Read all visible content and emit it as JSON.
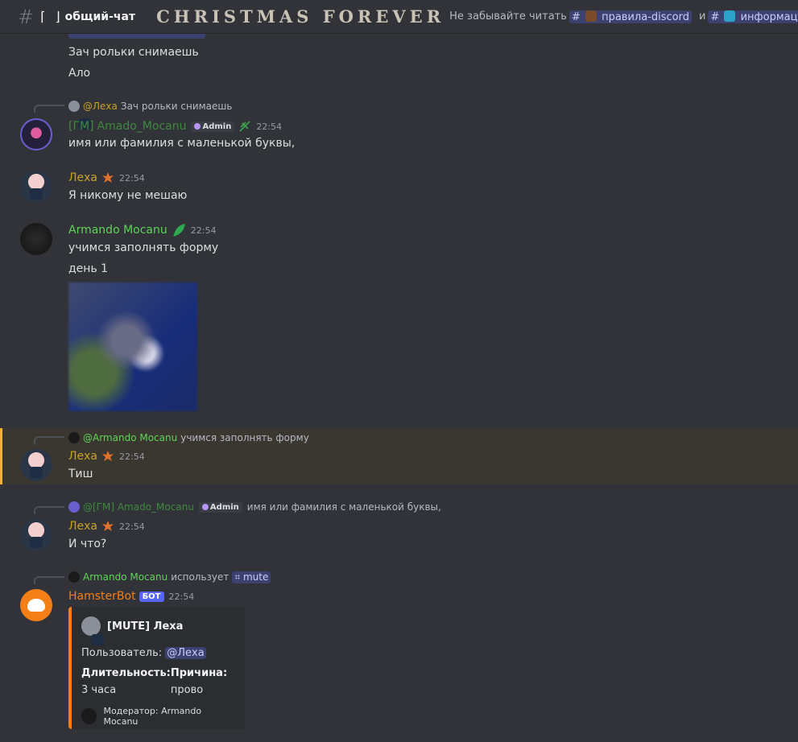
{
  "header": {
    "hash": "#",
    "bracket_open": "⌈",
    "bracket_close": "⌋",
    "channel_name": "общий-чат",
    "server_banner": "CHRISTMAS FOREVER",
    "topic_prefix": "Не забывайте читать",
    "rules_channel": "правила-discord",
    "topic_and": "и",
    "info_channel": "информаци"
  },
  "colors": {
    "lexa": "#c9a227",
    "armando": "#5fd35a",
    "gm": "#3e8a3e",
    "hamster": "#f57f17",
    "mention": "#c9cdfb"
  },
  "messages": {
    "m0": {
      "line1": "Зач рольки снимаешь",
      "line2": "Ало"
    },
    "m1": {
      "reply_name": "@Леха",
      "reply_text": "Зач рольки снимаешь",
      "prefix": "[ГМ]",
      "name": "Amado_Mocanu",
      "role": "Admin",
      "time": "22:54",
      "text": "имя или фамилия с маленькой буквы,"
    },
    "m2": {
      "name": "Леха",
      "time": "22:54",
      "text": "Я никому не мешаю"
    },
    "m3": {
      "name": "Armando Mocanu",
      "time": "22:54",
      "line1": "учимся заполнять форму",
      "line2": "день 1"
    },
    "m4": {
      "reply_name": "@Armando Mocanu",
      "reply_text": "учимся заполнять форму",
      "name": "Леха",
      "time": "22:54",
      "text": "Тиш"
    },
    "m5": {
      "reply_name": "@[ГМ] Amado_Mocanu",
      "reply_role": "Admin",
      "reply_text": "имя или фамилия с маленькой буквы,",
      "name": "Леха",
      "time": "22:54",
      "text": "И что?"
    },
    "m6": {
      "reply_name": "Armando Mocanu",
      "reply_uses": "использует",
      "reply_cmd": "mute",
      "name": "HamsterBot",
      "bot_tag": "БОТ",
      "time": "22:54",
      "embed": {
        "title": "[MUTE] Леха",
        "user_label": "Пользователь:",
        "user_mention": "@Леха",
        "duration_label": "Длительность:",
        "duration_value": "3 часа",
        "reason_label": "Причина:",
        "reason_value": "прово",
        "footer": "Модератор: Armando Mocanu"
      }
    }
  }
}
